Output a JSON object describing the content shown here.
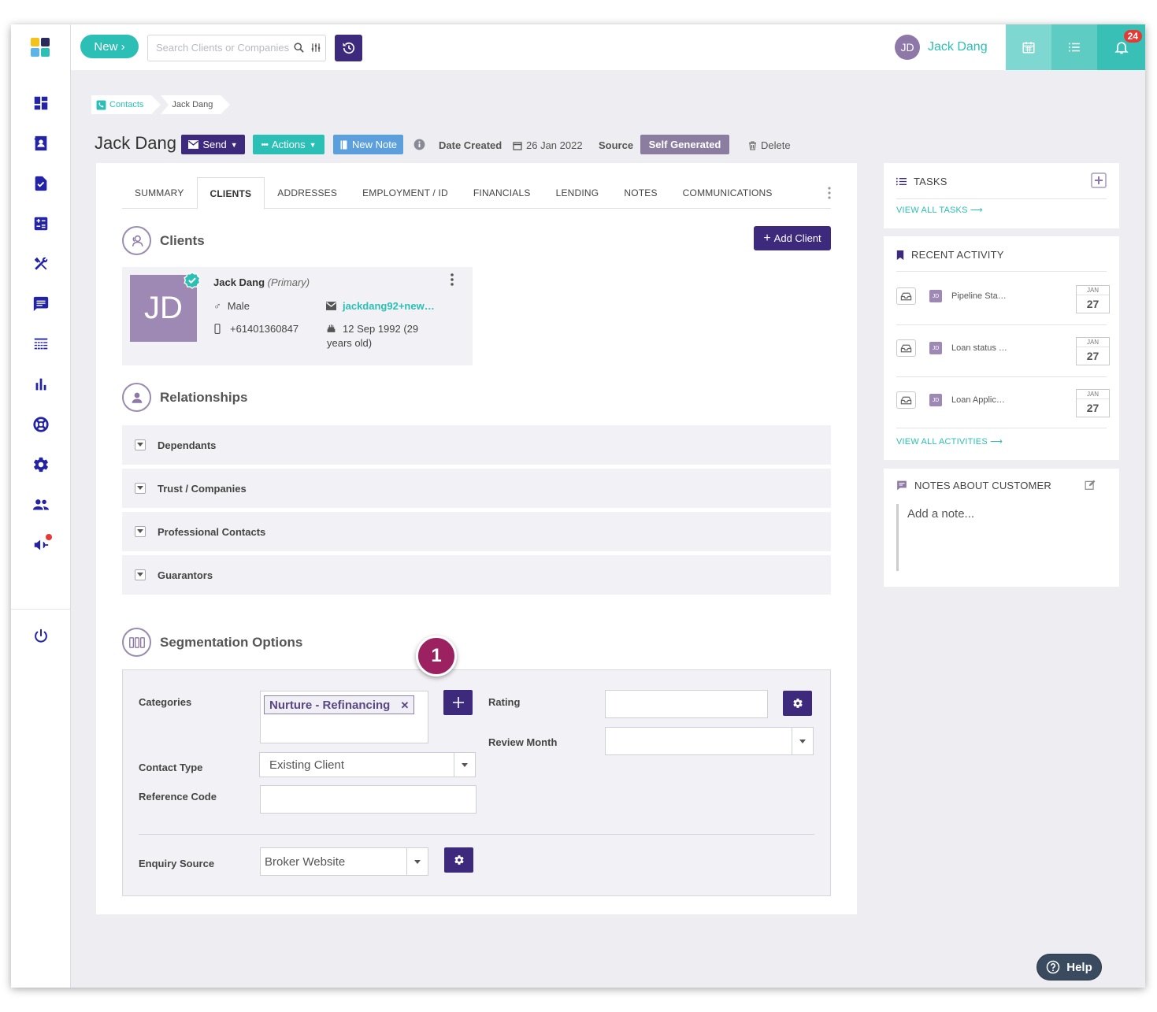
{
  "topbar": {
    "new_label": "New ›",
    "search_placeholder": "Search Clients or Companies",
    "user_initials": "JD",
    "user_name": "Jack Dang",
    "notifications_count": "24"
  },
  "sidebar": {
    "items": [
      "dashboard",
      "contacts",
      "applications",
      "calculators",
      "tools",
      "messages",
      "reports-table",
      "analytics",
      "support",
      "settings",
      "team",
      "marketing"
    ],
    "logout": "power-icon"
  },
  "breadcrumb": {
    "items": [
      "Contacts",
      "Jack Dang"
    ]
  },
  "header": {
    "title": "Jack Dang",
    "send_label": "Send",
    "actions_label": "Actions",
    "new_note_label": "New Note",
    "date_created_label": "Date Created",
    "date_created_value": "26 Jan 2022",
    "source_label": "Source",
    "source_value": "Self Generated",
    "delete_label": "Delete"
  },
  "tabs": [
    "SUMMARY",
    "CLIENTS",
    "ADDRESSES",
    "EMPLOYMENT / ID",
    "FINANCIALS",
    "LENDING",
    "NOTES",
    "COMMUNICATIONS"
  ],
  "active_tab": "CLIENTS",
  "clients": {
    "title": "Clients",
    "add_label": "Add Client",
    "card": {
      "initials": "JD",
      "name": "Jack Dang",
      "primary": "(Primary)",
      "gender": "Male",
      "email": "jackdang92+new…",
      "phone": "+61401360847",
      "dob_line1": "12 Sep 1992 (29",
      "dob_line2": "years old)"
    }
  },
  "relationships": {
    "title": "Relationships",
    "groups": [
      "Dependants",
      "Trust / Companies",
      "Professional Contacts",
      "Guarantors"
    ]
  },
  "step_marker": "1",
  "segmentation": {
    "title": "Segmentation Options",
    "categories_label": "Categories",
    "category_chip": "Nurture - Refinancing",
    "rating_label": "Rating",
    "rating_value": "",
    "review_month_label": "Review Month",
    "review_month_value": "",
    "contact_type_label": "Contact Type",
    "contact_type_value": "Existing Client",
    "reference_code_label": "Reference Code",
    "reference_code_value": "",
    "enquiry_source_label": "Enquiry Source",
    "enquiry_source_value": "Broker Website"
  },
  "tasks": {
    "title": "TASKS",
    "view_all": "VIEW ALL TASKS ⟶"
  },
  "recent_activity": {
    "title": "RECENT ACTIVITY",
    "items": [
      {
        "initials": "JD",
        "text": "Pipeline Sta…",
        "month": "JAN",
        "day": "27"
      },
      {
        "initials": "JD",
        "text": "Loan status …",
        "month": "JAN",
        "day": "27"
      },
      {
        "initials": "JD",
        "text": "Loan Applic…",
        "month": "JAN",
        "day": "27"
      }
    ],
    "view_all": "VIEW ALL ACTIVITIES ⟶"
  },
  "notes": {
    "title": "NOTES ABOUT CUSTOMER",
    "placeholder": "Add a note..."
  },
  "help_label": "Help",
  "colors": {
    "primary": "#3d2a7d",
    "accent": "#2bbfb6",
    "source_tag": "#8b7da0",
    "step_marker": "#9c2160"
  }
}
